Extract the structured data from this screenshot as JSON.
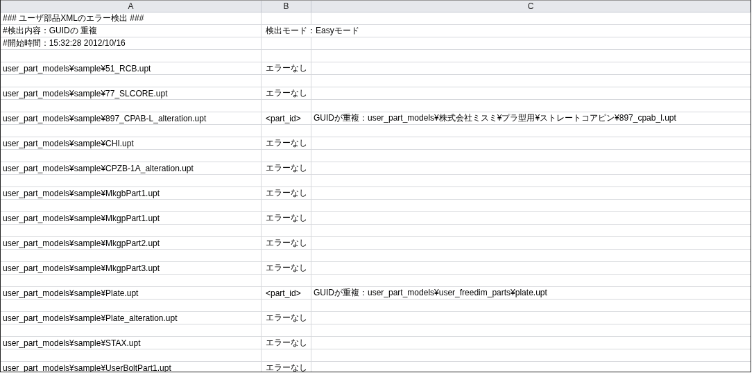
{
  "columns": [
    "A",
    "B",
    "C"
  ],
  "rows": [
    {
      "a": "### ユーザ部品XMLのエラー検出 ###"
    },
    {
      "a": "#検出内容：GUIDの 重複",
      "b": "検出モード：Easyモード"
    },
    {
      "a": "#開始時間：15:32:28 2012/10/16"
    },
    {},
    {
      "a": "user_part_models¥sample¥51_RCB.upt",
      "b": "エラーなし"
    },
    {},
    {
      "a": "user_part_models¥sample¥77_SLCORE.upt",
      "b": "エラーなし"
    },
    {},
    {
      "a": "user_part_models¥sample¥897_CPAB-L_alteration.upt",
      "b": "<part_id>",
      "c": "GUIDが重複：user_part_models¥株式会社ミスミ¥プラ型用¥ストレートコアピン¥897_cpab_l.upt"
    },
    {},
    {
      "a": "user_part_models¥sample¥CHI.upt",
      "b": "エラーなし"
    },
    {},
    {
      "a": "user_part_models¥sample¥CPZB-1A_alteration.upt",
      "b": "エラーなし"
    },
    {},
    {
      "a": "user_part_models¥sample¥MkgbPart1.upt",
      "b": "エラーなし"
    },
    {},
    {
      "a": "user_part_models¥sample¥MkgpPart1.upt",
      "b": "エラーなし"
    },
    {},
    {
      "a": "user_part_models¥sample¥MkgpPart2.upt",
      "b": "エラーなし"
    },
    {},
    {
      "a": "user_part_models¥sample¥MkgpPart3.upt",
      "b": "エラーなし"
    },
    {},
    {
      "a": "user_part_models¥sample¥Plate.upt",
      "b": "<part_id>",
      "c": "GUIDが重複：user_part_models¥user_freedim_parts¥plate.upt"
    },
    {},
    {
      "a": "user_part_models¥sample¥Plate_alteration.upt",
      "b": "エラーなし"
    },
    {},
    {
      "a": "user_part_models¥sample¥STAX.upt",
      "b": "エラーなし"
    },
    {},
    {
      "a": "user_part_models¥sample¥UserBoltPart1.upt",
      "b": "エラーなし"
    }
  ]
}
